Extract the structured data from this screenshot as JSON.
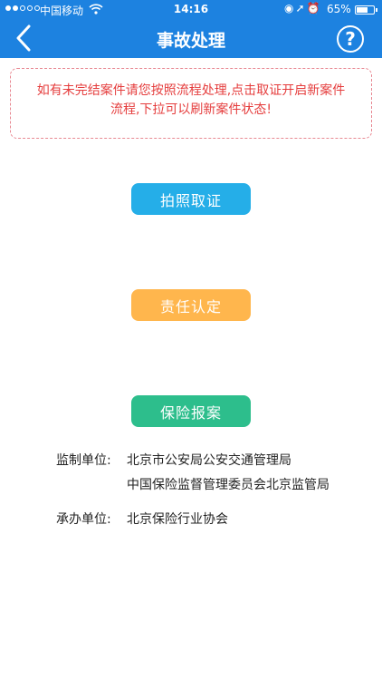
{
  "status_bar": {
    "carrier": "中国移动",
    "time": "14:16",
    "battery": "65%",
    "battery_level": 0.65,
    "icons": [
      "signal-icon",
      "wifi-icon",
      "orientation-lock-icon",
      "location-icon",
      "alarm-icon",
      "battery-icon"
    ]
  },
  "header": {
    "title": "事故处理",
    "help_label": "?",
    "icons": [
      "back-icon",
      "help-icon"
    ],
    "background_color": "#1d82e0"
  },
  "notice": {
    "line1": "如有未完结案件请您按照流程处理,点击取证开启新案件",
    "line2": "流程,下拉可以刷新案件状态!",
    "color": "#e53d3d"
  },
  "buttons": [
    {
      "label": "拍照取证",
      "color": "#25aee8"
    },
    {
      "label": "责任认定",
      "color": "#ffb64d"
    },
    {
      "label": "保险报案",
      "color": "#2dbe8c"
    }
  ],
  "info": {
    "supervisor_label": "监制单位:",
    "supervisor_1": "北京市公安局公安交通管理局",
    "supervisor_2": "中国保险监督管理委员会北京监管局",
    "organizer_label": "承办单位:",
    "organizer": "北京保险行业协会"
  }
}
